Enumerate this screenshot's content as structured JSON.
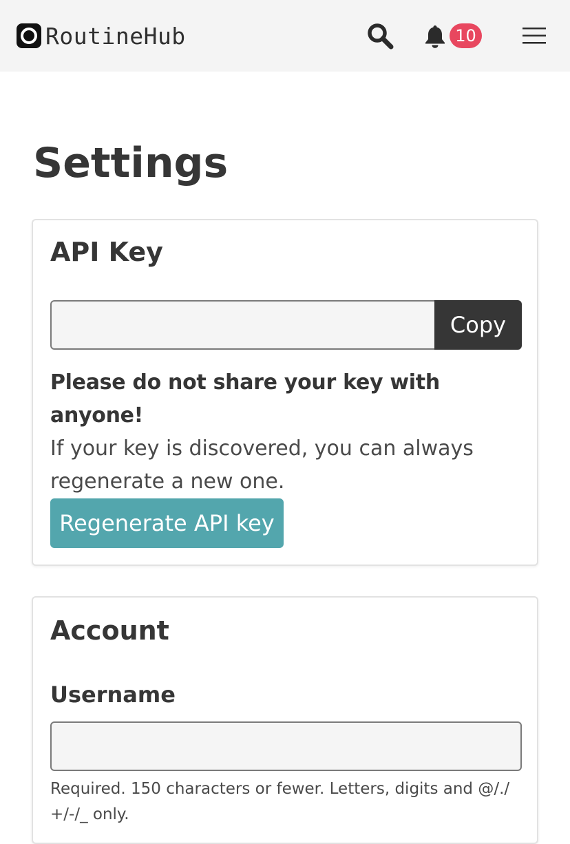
{
  "navbar": {
    "brand_name": "RoutineHub",
    "notification_count": "10"
  },
  "page": {
    "title": "Settings"
  },
  "api_key": {
    "title": "API Key",
    "key_value": "",
    "copy_label": "Copy",
    "warning_strong": "Please do not share your key with anyone!",
    "warning_text": "If your key is discovered, you can always regenerate a new one.",
    "regenerate_label": "Regenerate API key"
  },
  "account": {
    "title": "Account",
    "username_label": "Username",
    "username_value": "",
    "username_help": "Required. 150 characters or fewer. Letters, digits and @/./+/-/_ only."
  },
  "colors": {
    "navbar_bg": "#f4f4f4",
    "badge": "#e8475f",
    "regenerate_button": "#53a6ad",
    "copy_button": "#363636"
  }
}
